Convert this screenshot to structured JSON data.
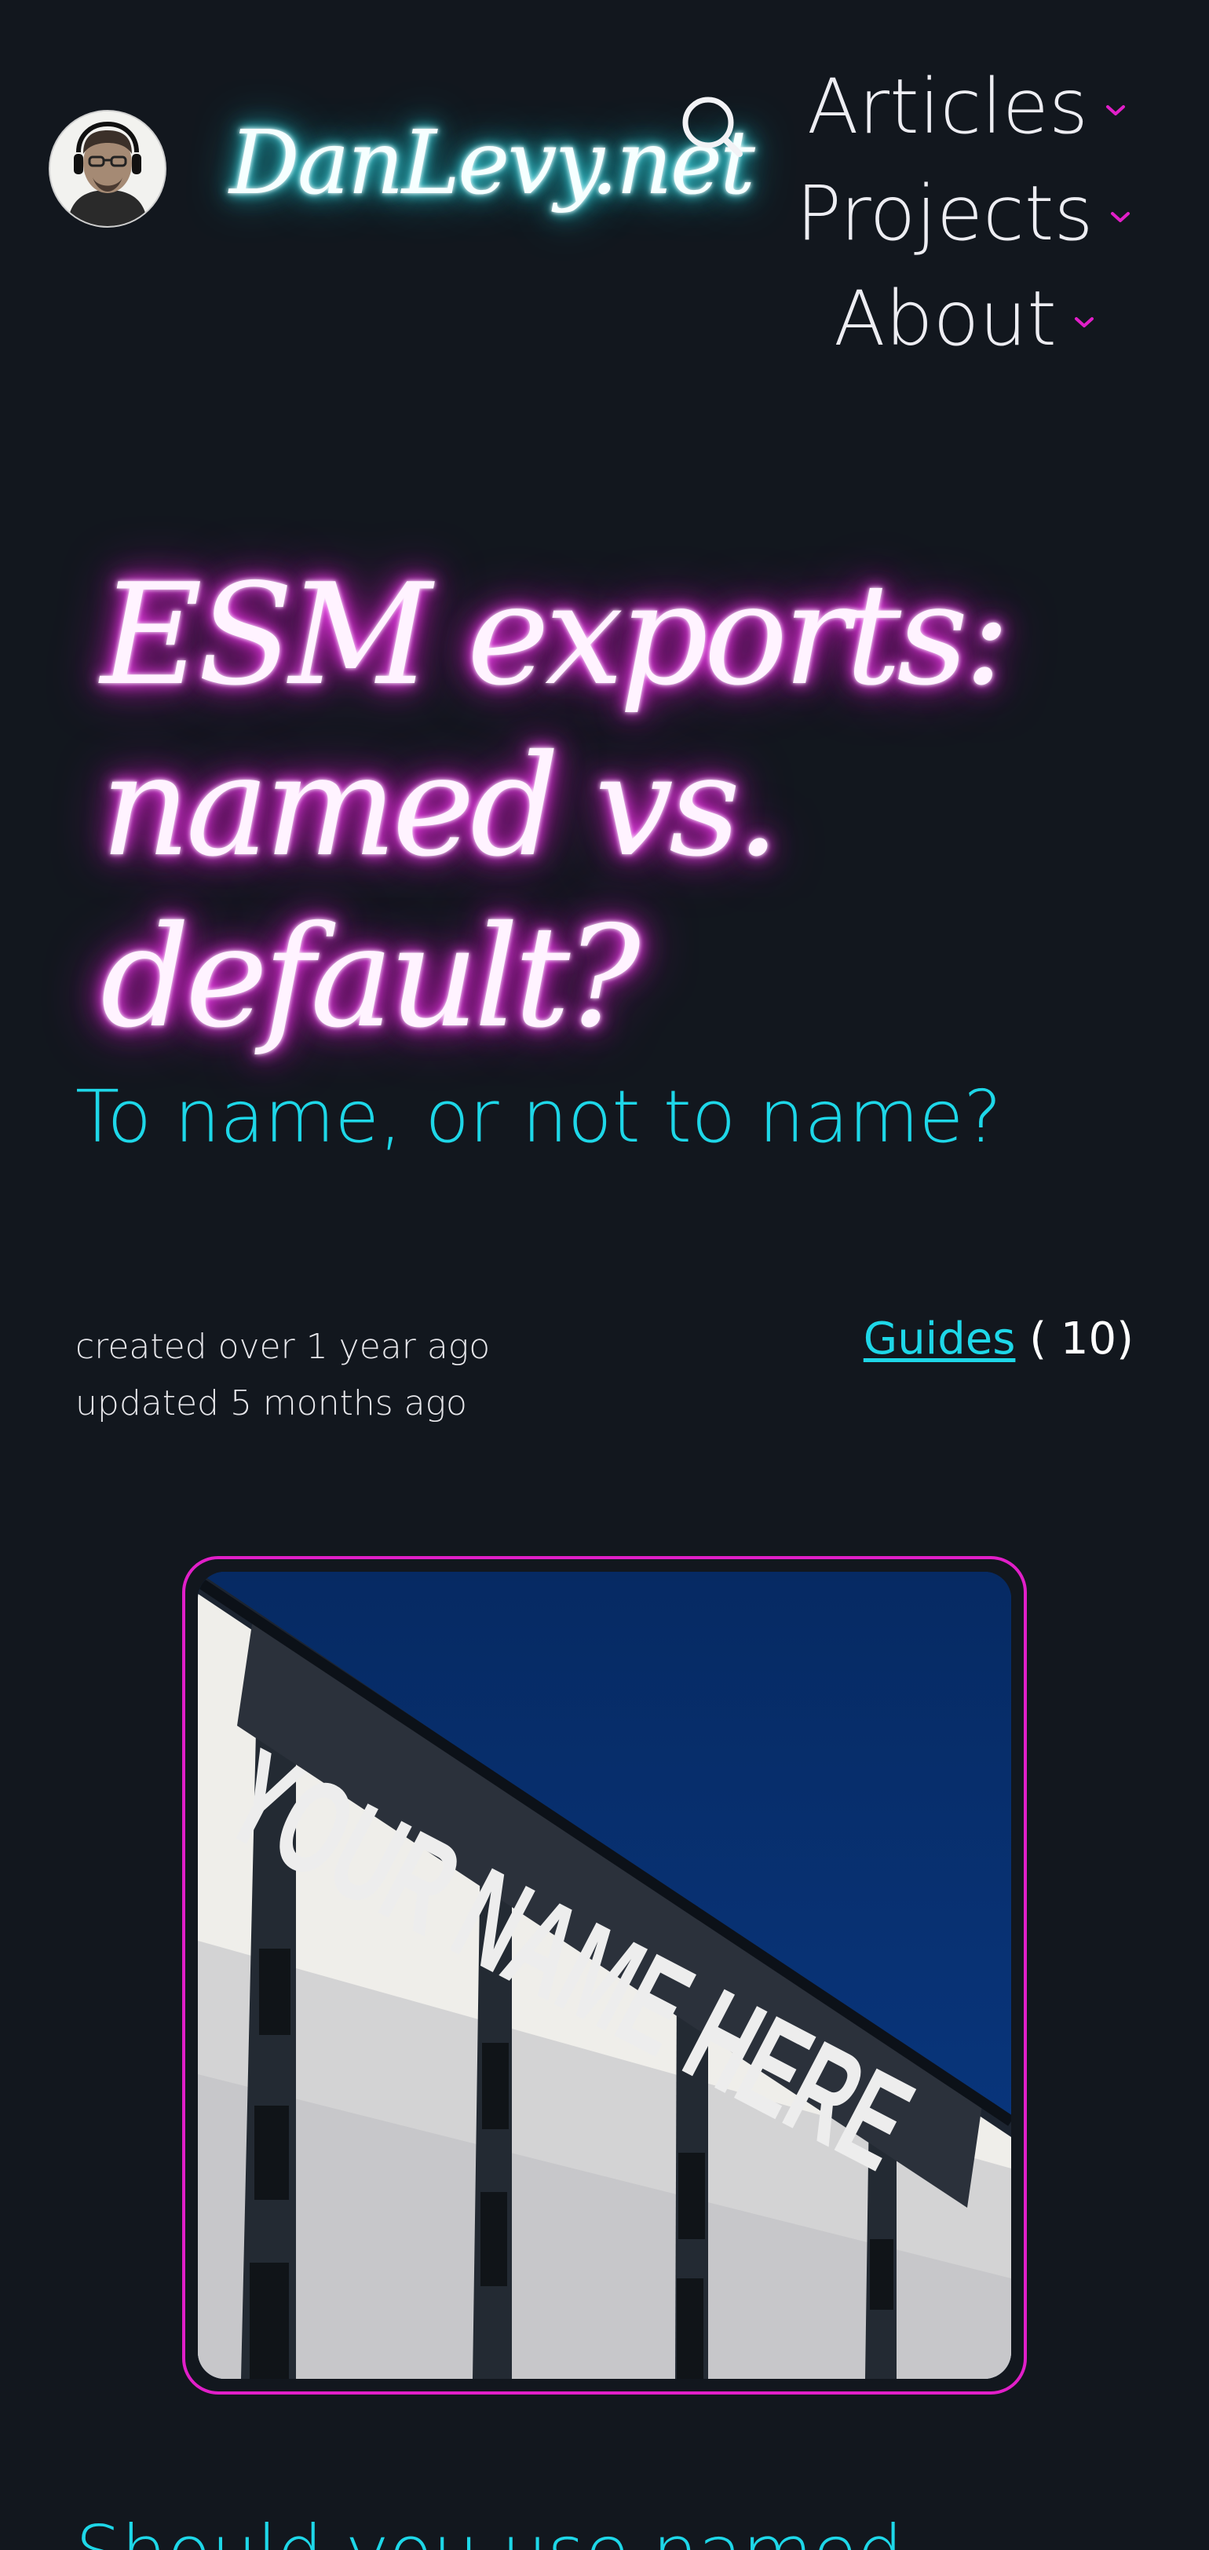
{
  "header": {
    "site_name": "DanLevy.net",
    "nav": [
      {
        "label": "Articles"
      },
      {
        "label": "Projects"
      },
      {
        "label": "About"
      }
    ]
  },
  "post": {
    "title_line1": "ESM exports:",
    "title_line2": "named vs. default?",
    "subtitle": "To name, or not to name?",
    "created": "created over 1 year ago",
    "updated": "updated 5 months ago",
    "category": "Guides",
    "category_count": "( 10)",
    "hero_image_text": "YOUR NAME HERE",
    "next_heading": "Should you use named"
  },
  "icons": {
    "search": "search-icon",
    "nav_chevron": "chevron-down-icon"
  },
  "colors": {
    "background": "#12171e",
    "accent_cyan": "#1ed7e8",
    "accent_magenta": "#e11fc8",
    "text": "#e8e8ee"
  }
}
